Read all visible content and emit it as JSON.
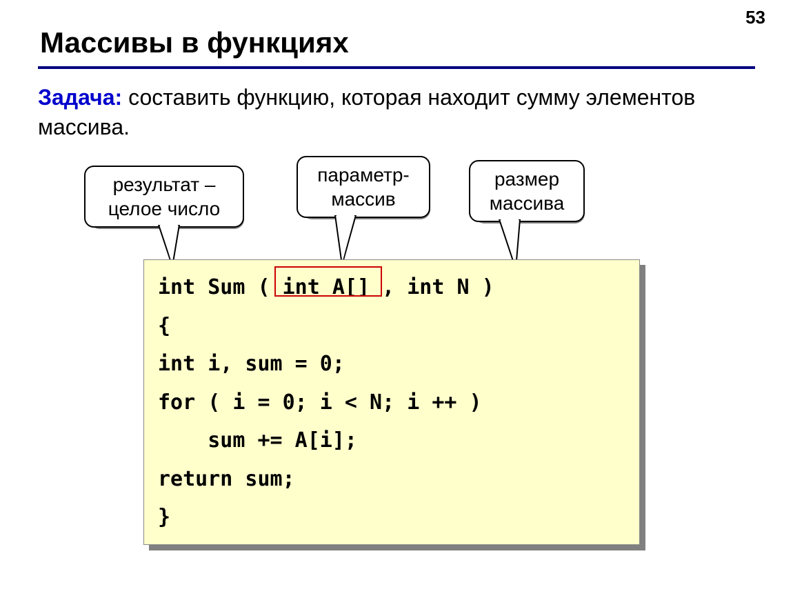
{
  "pageNumber": "53",
  "title": "Массивы в функциях",
  "task": {
    "label": "Задача:",
    "text": " составить функцию, которая находит сумму элементов массива."
  },
  "callouts": {
    "result": {
      "line1": "результат –",
      "line2": "целое число"
    },
    "param": {
      "line1": "параметр-",
      "line2": "массив"
    },
    "size": {
      "line1": "размер",
      "line2": "массива"
    }
  },
  "code": {
    "l1a": "int Sum ( ",
    "l1b": "int A[]",
    "l1c": " , int N )",
    "l2": "{",
    "l3": "int i, sum = 0;",
    "l4": "for ( i = 0; i < N; i ++ )",
    "l5": "    sum += A[i];",
    "l6": "return sum;",
    "l7": "}"
  }
}
